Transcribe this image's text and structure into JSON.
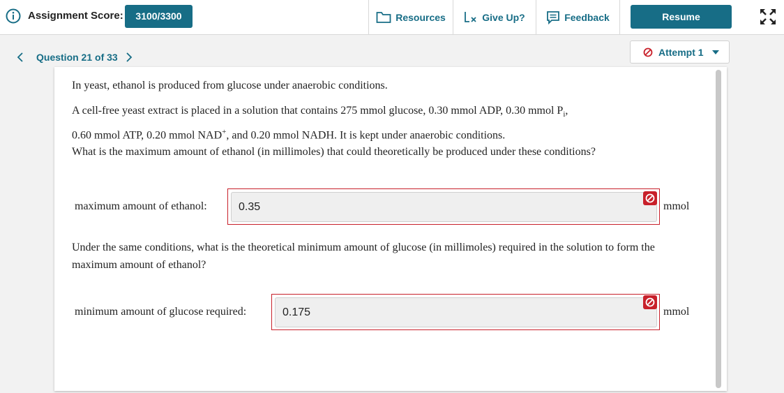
{
  "header": {
    "score_label": "Assignment Score:",
    "score_value": "3100/3300",
    "resources_label": "Resources",
    "giveup_label": "Give Up?",
    "feedback_label": "Feedback",
    "resume_label": "Resume"
  },
  "nav": {
    "question_label": "Question 21 of 33",
    "attempt_label": "Attempt 1"
  },
  "question": {
    "intro": "In yeast, ethanol is produced from glucose under anaerobic conditions.",
    "setup_part1": "A cell-free yeast extract is placed in a solution that contains 275 mmol glucose, 0.30 mmol ADP, 0.30 mmol P",
    "setup_sub_i": "i",
    "setup_part2": ",",
    "setup_part3": "0.60 mmol ATP, 0.20 mmol NAD",
    "setup_sup_plus": "+",
    "setup_part4": ", and 0.20 mmol NADH. It is kept under anaerobic conditions.",
    "prompt1": "What is the maximum amount of ethanol (in millimoles) that could theoretically be produced under these conditions?",
    "prompt2": "Under the same conditions, what is the theoretical minimum amount of glucose (in millimoles) required in the solution to form the maximum amount of ethanol?"
  },
  "answers": [
    {
      "label": "maximum amount of ethanol:",
      "value": "0.35",
      "unit": "mmol",
      "status": "incorrect"
    },
    {
      "label": "minimum amount of glucose required:",
      "value": "0.175",
      "unit": "mmol",
      "status": "incorrect"
    }
  ],
  "colors": {
    "accent": "#176d86",
    "error": "#c8202a"
  },
  "icons": [
    "info-icon",
    "folder-icon",
    "give-up-icon",
    "feedback-icon",
    "expand-icon",
    "chevron-left-icon",
    "chevron-right-icon",
    "no-entry-icon",
    "caret-down-icon"
  ]
}
